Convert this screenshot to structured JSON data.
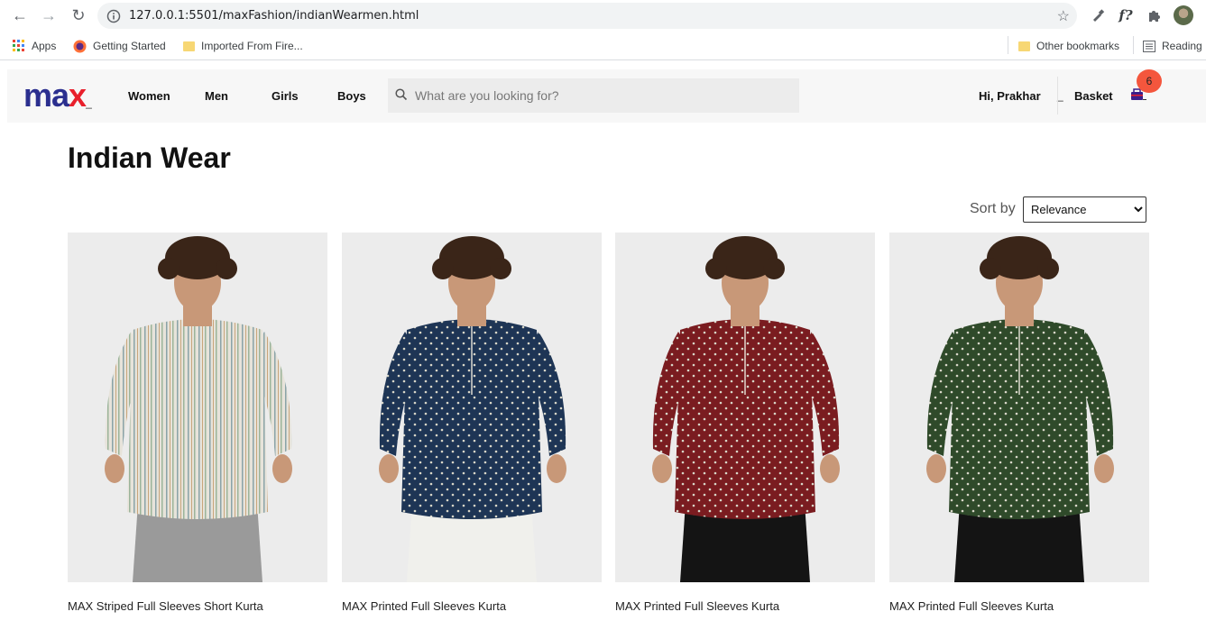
{
  "browser": {
    "url": "127.0.0.1:5501/maxFashion/indianWearmen.html",
    "bookmarks": {
      "apps": "Apps",
      "getting_started": "Getting Started",
      "imported": "Imported From Fire...",
      "other": "Other bookmarks",
      "reading": "Reading"
    }
  },
  "header": {
    "logo": {
      "part1": "ma",
      "part2": "x"
    },
    "nav": [
      "Women",
      "Men",
      "Girls",
      "Boys"
    ],
    "search_placeholder": "What are you looking for?",
    "greeting": "Hi, Prakhar",
    "basket_label": "Basket",
    "basket_count": "6"
  },
  "page": {
    "title": "Indian Wear",
    "sort_label": "Sort by",
    "sort_selected": "Relevance"
  },
  "products": [
    {
      "name": "MAX Striped Full Sleeves Short Kurta",
      "shirt_color": "#e7e3da",
      "pattern": "stripes",
      "pants_color": "#9a9a9a",
      "skin": "#c89878"
    },
    {
      "name": "MAX Printed Full Sleeves Kurta",
      "shirt_color": "#1e3555",
      "pattern": "dots-light",
      "pants_color": "#f0f0ec",
      "skin": "#c89878"
    },
    {
      "name": "MAX Printed Full Sleeves Kurta",
      "shirt_color": "#7a1c20",
      "pattern": "dots-light",
      "pants_color": "#141414",
      "skin": "#c89878"
    },
    {
      "name": "MAX Printed Full Sleeves Kurta",
      "shirt_color": "#2f4a2a",
      "pattern": "dots-light",
      "pants_color": "#141414",
      "skin": "#c89878"
    }
  ],
  "colors": {
    "brand_blue": "#2b2f8f",
    "brand_red": "#e8202c",
    "badge": "#f4563d",
    "header_bg": "#f7f7f7"
  }
}
